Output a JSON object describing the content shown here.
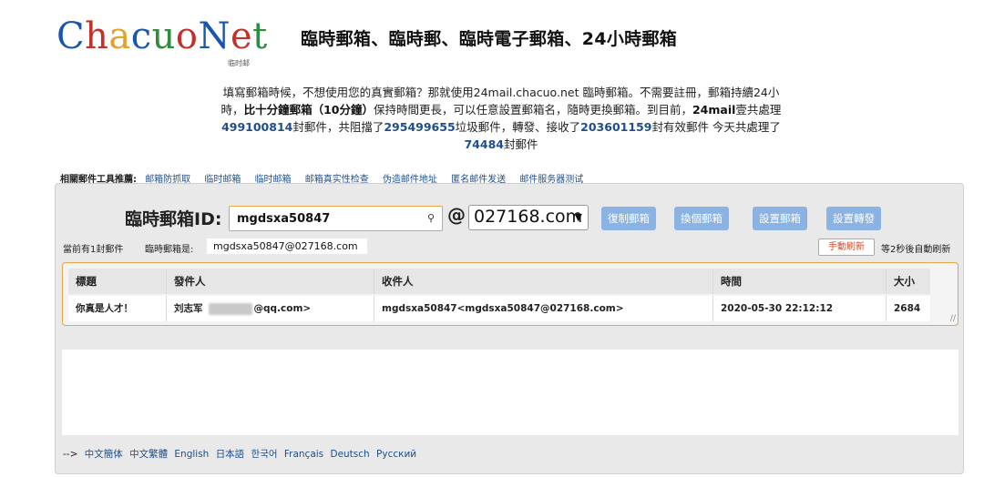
{
  "logo": {
    "text": "ChacuoNet",
    "subtext": "临时邮",
    "letter_colors": [
      "#1a55b0",
      "#c4312b",
      "#e3a32b",
      "#1a55b0",
      "#2e8b3f",
      "#c4312b",
      "#1a55b0",
      "#c4312b",
      "#2e8b3f"
    ]
  },
  "headline": "臨時郵箱、臨時郵、臨時電子郵箱、24小時郵箱",
  "intro": {
    "line1": "填寫郵箱時候，不想使用您的真實郵箱？那就使用24mail.chacuo.net 臨時郵箱。不需要註冊，郵箱持續24小",
    "line2_a": "時，",
    "line2_bold": "比十分鐘郵箱（10分鐘）",
    "line2_b": "保持時間更長，可以任意設置郵箱名，隨時更換郵箱。到目前，",
    "line2_bold2": "24mail",
    "line2_c": "壹共處理",
    "num_total": "499100814",
    "line3_a": "封郵件，共阻擋了",
    "num_blocked": "295499655",
    "line3_b": "垃圾郵件，轉發、接收了",
    "num_valid": "203601159",
    "line3_c": "封有效郵件 今天共處理了",
    "num_today": "74484",
    "line4": "封郵件"
  },
  "tools": {
    "label": "相關郵件工具推薦:",
    "links": [
      "邮箱防抓取",
      "临时邮箱",
      "临时邮箱",
      "邮箱真实性检查",
      "伪造邮件地址",
      "匿名邮件发送",
      "邮件服务器测试"
    ]
  },
  "mailbox": {
    "id_label": "臨時郵箱ID:",
    "id_value": "mgdsxa50847",
    "key_icon": "key-icon",
    "at": "@",
    "domain": "027168.com",
    "buttons": {
      "copy": "復制郵箱",
      "change": "換個郵箱",
      "settings": "設置郵箱",
      "forward": "設置轉發"
    },
    "button_color": "#8ab2e2"
  },
  "status": {
    "message_count": "當前有1封郵件",
    "address_label": "臨時郵箱是:",
    "address": "mgdsxa50847@027168.com",
    "refresh_button": "手動刷新",
    "auto_refresh": "等2秒後自動刷新"
  },
  "table": {
    "headers": [
      "標題",
      "發件人",
      "收件人",
      "時間",
      "大小"
    ],
    "rows": [
      {
        "subject": "你真是人才！",
        "sender_name": "刘志军",
        "sender_email_suffix": "@qq.com>",
        "recipient": "mgdsxa50847<mgdsxa50847@027168.com>",
        "time": "2020-05-30 22:12:12",
        "size": "2684"
      }
    ]
  },
  "languages": {
    "prefix": "-->",
    "items": [
      "中文簡体",
      "中文繁體",
      "English",
      "日本語",
      "한국어",
      "Français",
      "Deutsch",
      "Русский"
    ]
  },
  "colors": {
    "accent_orange": "#e3a545",
    "link_blue": "#1f4e8c",
    "refresh_red": "#d34a2a"
  }
}
